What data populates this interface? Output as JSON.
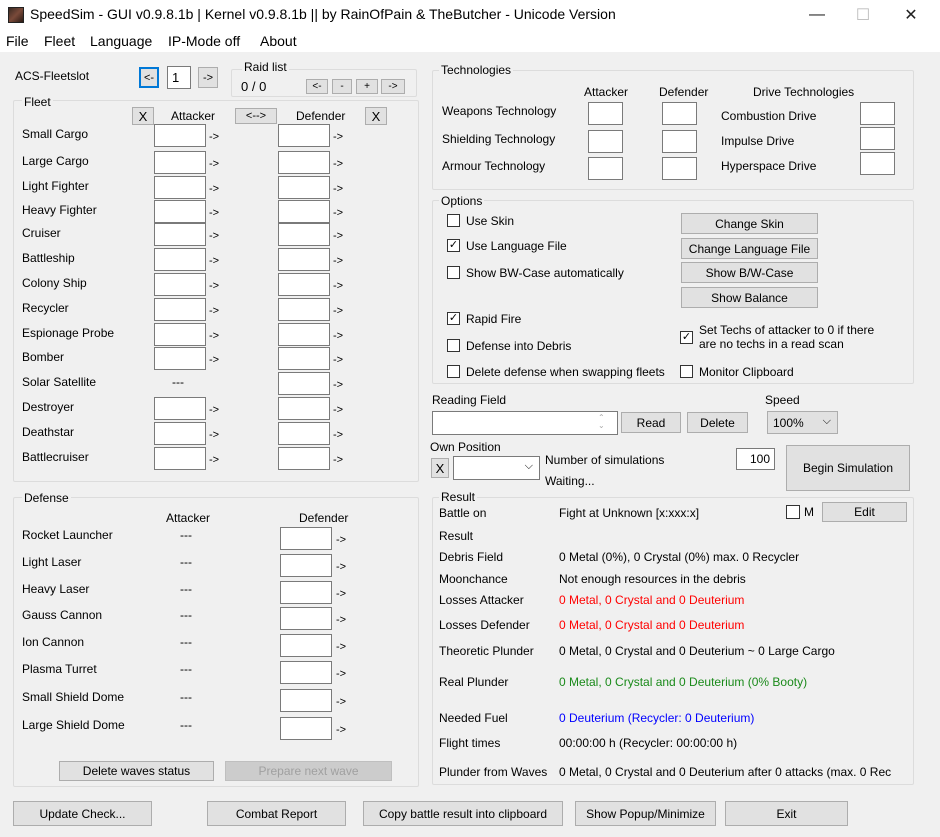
{
  "window": {
    "title": "SpeedSim - GUI v0.9.8.1b | Kernel v0.9.8.1b  ||  by RainOfPain & TheButcher - Unicode Version",
    "minimize": "—",
    "maximize": "☐",
    "close": "✕"
  },
  "menu": [
    "File",
    "Fleet",
    "Language",
    "IP-Mode off",
    "About"
  ],
  "acs": {
    "label": "ACS-Fleetslot",
    "prev": "<-",
    "value": "1",
    "next": "->"
  },
  "raid_list": {
    "label": "Raid list",
    "counter": "0 / 0",
    "buttons": [
      "<-",
      "-",
      "+",
      "->"
    ]
  },
  "fleet": {
    "label": "Fleet",
    "clear_attacker": "X",
    "attacker_header": "Attacker",
    "swap": "<-->",
    "defender_header": "Defender",
    "clear_defender": "X",
    "arrow": "->",
    "na": "---",
    "ships": [
      {
        "name": "Small Cargo",
        "attacker": true
      },
      {
        "name": "Large Cargo",
        "attacker": true
      },
      {
        "name": "Light Fighter",
        "attacker": true
      },
      {
        "name": "Heavy Fighter",
        "attacker": true
      },
      {
        "name": "Cruiser",
        "attacker": true
      },
      {
        "name": "Battleship",
        "attacker": true
      },
      {
        "name": "Colony Ship",
        "attacker": true
      },
      {
        "name": "Recycler",
        "attacker": true
      },
      {
        "name": "Espionage Probe",
        "attacker": true
      },
      {
        "name": "Bomber",
        "attacker": true
      },
      {
        "name": "Solar Satellite",
        "attacker": false
      },
      {
        "name": "Destroyer",
        "attacker": true
      },
      {
        "name": "Deathstar",
        "attacker": true
      },
      {
        "name": "Battlecruiser",
        "attacker": true
      }
    ]
  },
  "defense": {
    "label": "Defense",
    "attacker_header": "Attacker",
    "defender_header": "Defender",
    "na": "---",
    "arrow": "->",
    "items": [
      "Rocket Launcher",
      "Light Laser",
      "Heavy Laser",
      "Gauss Cannon",
      "Ion Cannon",
      "Plasma Turret",
      "Small Shield Dome",
      "Large Shield Dome"
    ],
    "delete_waves": "Delete waves status",
    "prepare_next_wave": "Prepare next wave"
  },
  "technologies": {
    "label": "Technologies",
    "attacker_header": "Attacker",
    "defender_header": "Defender",
    "drive_header": "Drive Technologies",
    "techs": [
      "Weapons Technology",
      "Shielding Technology",
      "Armour Technology"
    ],
    "drives": [
      "Combustion Drive",
      "Impulse Drive",
      "Hyperspace Drive"
    ]
  },
  "options": {
    "label": "Options",
    "use_skin": {
      "label": "Use Skin",
      "checked": false
    },
    "use_language_file": {
      "label": "Use Language File",
      "checked": true
    },
    "show_bw_auto": {
      "label": "Show BW-Case automatically",
      "checked": false
    },
    "rapid_fire": {
      "label": "Rapid Fire",
      "checked": true
    },
    "defense_into_debris": {
      "label": "Defense into Debris",
      "checked": false
    },
    "delete_defense_swap": {
      "label": "Delete defense when swapping fleets",
      "checked": false
    },
    "set_techs_zero": {
      "label": "Set Techs of attacker to 0 if there are no techs in a read scan",
      "line1": "Set Techs of attacker to 0 if there",
      "line2": "are no techs in a read scan",
      "checked": true
    },
    "monitor_clipboard": {
      "label": "Monitor Clipboard",
      "checked": false
    },
    "change_skin": "Change Skin",
    "change_language_file": "Change Language File",
    "show_bw_case": "Show B/W-Case",
    "show_balance": "Show Balance"
  },
  "reading": {
    "label": "Reading Field",
    "value": "",
    "read": "Read",
    "delete": "Delete",
    "speed_label": "Speed",
    "speed_value": "100%"
  },
  "own_position": {
    "label": "Own Position",
    "clear": "X",
    "value": "",
    "num_sims_label": "Number of simulations",
    "num_sims_value": "100",
    "status": "Waiting...",
    "begin": "Begin Simulation"
  },
  "result": {
    "label": "Result",
    "m_label": "M",
    "m_checked": false,
    "edit": "Edit",
    "rows": [
      {
        "key": "Battle on",
        "value": "Fight at Unknown [x:xxx:x]",
        "color": "black"
      },
      {
        "key": "Result",
        "value": "",
        "color": "black"
      },
      {
        "key": "Debris Field",
        "value": "0 Metal (0%), 0 Crystal (0%) max. 0 Recycler",
        "color": "black"
      },
      {
        "key": "Moonchance",
        "value": "Not enough resources in the debris",
        "color": "black"
      },
      {
        "key": "Losses Attacker",
        "value": "0 Metal, 0 Crystal and 0 Deuterium",
        "color": "red"
      },
      {
        "key": "Losses Defender",
        "value": "0 Metal, 0 Crystal and 0 Deuterium",
        "color": "red"
      },
      {
        "key": "Theoretic Plunder",
        "value": "0 Metal, 0 Crystal and 0 Deuterium ~ 0 Large Cargo",
        "color": "black"
      },
      {
        "key": "Real Plunder",
        "value": "0 Metal, 0 Crystal and 0 Deuterium (0% Booty)",
        "color": "green"
      },
      {
        "key": "Needed Fuel",
        "value": "0 Deuterium (Recycler: 0 Deuterium)",
        "color": "blue"
      },
      {
        "key": "Flight times",
        "value": "00:00:00 h (Recycler: 00:00:00 h)",
        "color": "black"
      },
      {
        "key": "Plunder from Waves",
        "value": "0 Metal, 0 Crystal and 0 Deuterium after 0 attacks (max. 0 Rec",
        "color": "black"
      }
    ]
  },
  "bottom": {
    "update_check": "Update Check...",
    "combat_report": "Combat Report",
    "copy_result": "Copy battle result into clipboard",
    "show_popup": "Show Popup/Minimize",
    "exit": "Exit"
  }
}
